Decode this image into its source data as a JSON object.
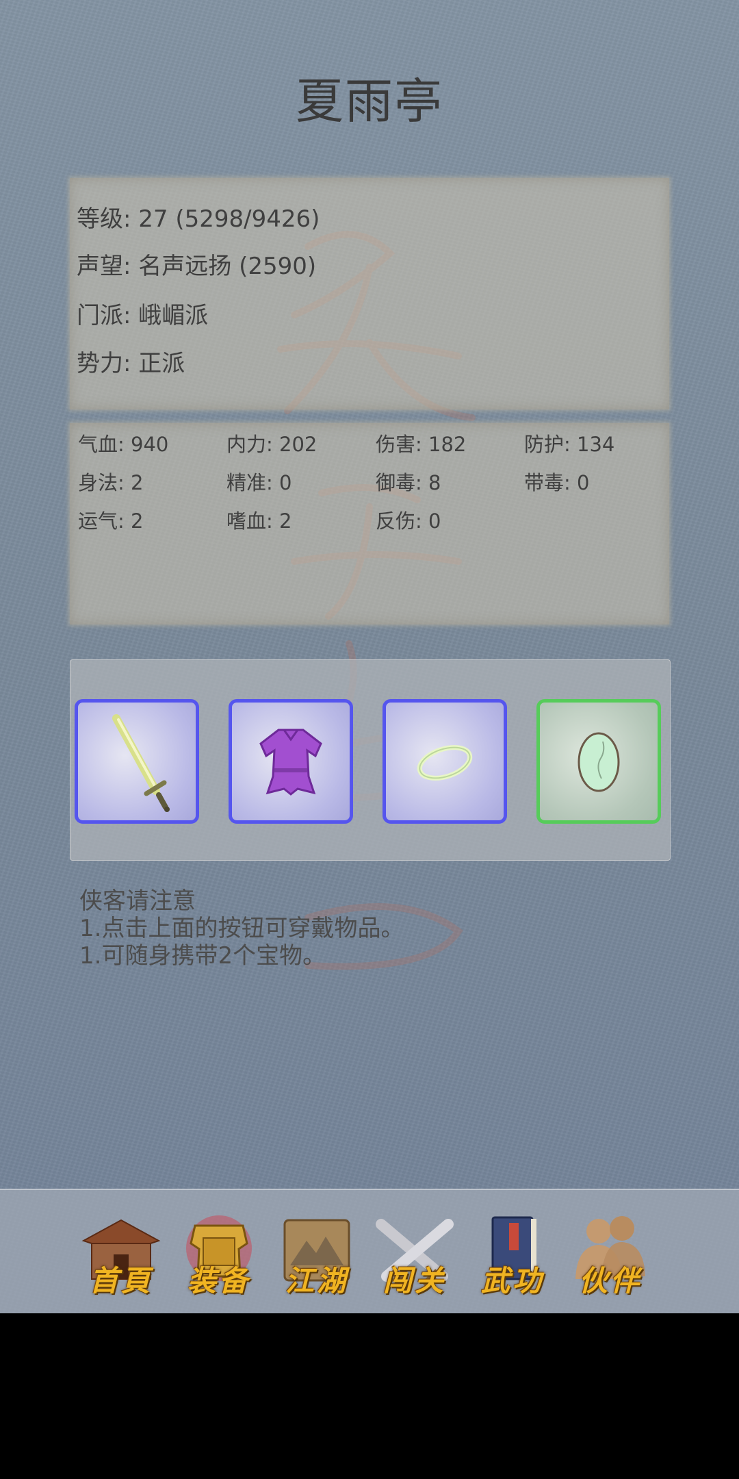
{
  "header": {
    "title": "夏雨亭"
  },
  "info": {
    "level": "等级: 27 (5298/9426)",
    "reputation": "声望: 名声远扬 (2590)",
    "sect": "门派: 峨嵋派",
    "faction": "势力:  正派"
  },
  "stats": [
    "气血: 940",
    "内力: 202",
    "伤害: 182",
    "防护: 134",
    "身法: 2",
    "精准: 0",
    "御毒: 8",
    "带毒: 0",
    "运气: 2",
    "嗜血: 2",
    "反伤: 0"
  ],
  "equipment": [
    {
      "icon": "sword-icon",
      "border_color": "#5555ee"
    },
    {
      "icon": "robe-icon",
      "border_color": "#5555ee"
    },
    {
      "icon": "jade-ring-icon",
      "border_color": "#5555ee"
    },
    {
      "icon": "jade-egg-icon",
      "border_color": "#56cc5a"
    }
  ],
  "notes": {
    "heading": "侠客请注意",
    "line1": "1.点击上面的按钮可穿戴物品。",
    "line2": "1.可随身携带2个宝物。"
  },
  "nav": {
    "home": "首頁",
    "equipment": "装备",
    "jianghu": "江湖",
    "challenge": "闯关",
    "martial": "武功",
    "partner": "伙伴"
  }
}
